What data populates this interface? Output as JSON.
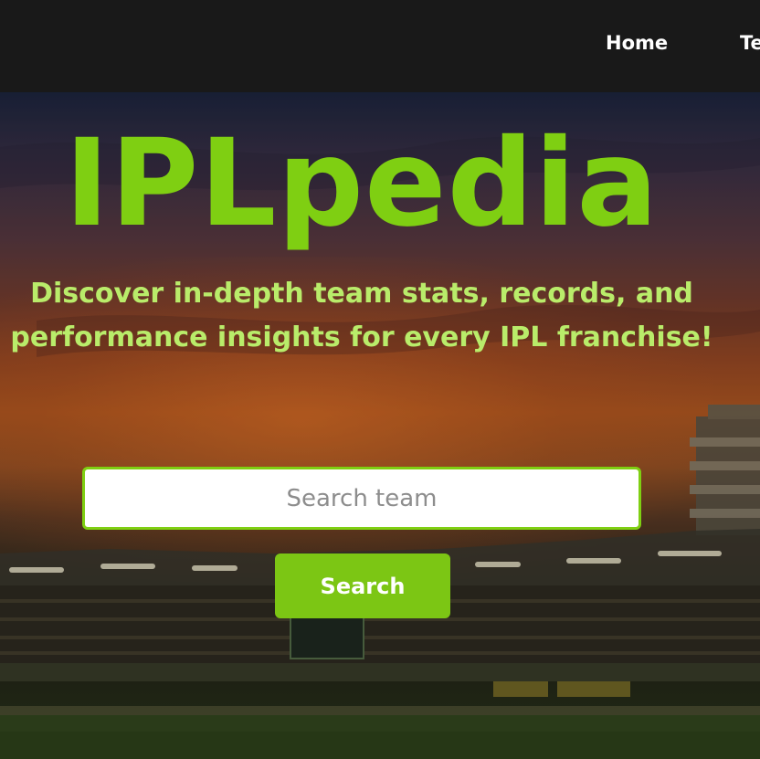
{
  "nav": {
    "links": [
      {
        "label": "Home"
      },
      {
        "label": "Te"
      }
    ]
  },
  "hero": {
    "title": "IPLpedia",
    "tagline_line1": "Discover in-depth team stats, records, and",
    "tagline_line2": "performance insights for every IPL franchise!"
  },
  "search": {
    "placeholder": "Search team",
    "button_label": "Search"
  },
  "colors": {
    "accent": "#7fcf12",
    "button": "#7cc614",
    "tagline": "#b9ec6a",
    "navbar": "#191919"
  }
}
